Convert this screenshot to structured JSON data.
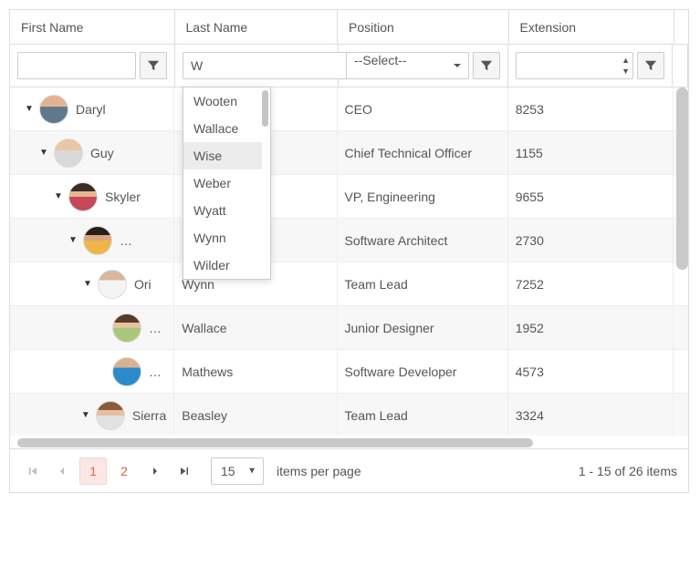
{
  "headers": {
    "firstName": "First Name",
    "lastName": "Last Name",
    "position": "Position",
    "extension": "Extension"
  },
  "filters": {
    "lastNameValue": "W",
    "positionPlaceholder": "--Select--"
  },
  "autocomplete": [
    "Wooten",
    "Wallace",
    "Wise",
    "Weber",
    "Wyatt",
    "Wynn",
    "Wilder"
  ],
  "rows": [
    {
      "first": "Daryl",
      "last": "",
      "pos": "CEO",
      "ext": "8253",
      "depth": 0,
      "alt": false,
      "expand": true,
      "trunc": false
    },
    {
      "first": "Guy",
      "last": "",
      "pos": "Chief Technical Officer",
      "ext": "1155",
      "depth": 1,
      "alt": true,
      "expand": true,
      "trunc": false
    },
    {
      "first": "Skyler",
      "last": "",
      "pos": "VP, Engineering",
      "ext": "9655",
      "depth": 2,
      "alt": false,
      "expand": true,
      "trunc": false
    },
    {
      "first": "",
      "last": "",
      "pos": "Software Architect",
      "ext": "2730",
      "depth": 3,
      "alt": true,
      "expand": true,
      "trunc": true
    },
    {
      "first": "Ori",
      "last": "Wynn",
      "pos": "Team Lead",
      "ext": "7252",
      "depth": 4,
      "alt": false,
      "expand": true,
      "trunc": false
    },
    {
      "first": "",
      "last": "Wallace",
      "pos": "Junior Designer",
      "ext": "1952",
      "depth": 5,
      "alt": true,
      "expand": false,
      "trunc": true
    },
    {
      "first": "",
      "last": "Mathews",
      "pos": "Software Developer",
      "ext": "4573",
      "depth": 5,
      "alt": false,
      "expand": false,
      "trunc": true
    },
    {
      "first": "Sierra",
      "last": "Beasley",
      "pos": "Team Lead",
      "ext": "3324",
      "depth": 4,
      "alt": true,
      "expand": true,
      "trunc": false
    }
  ],
  "pager": {
    "pages": [
      "1",
      "2"
    ],
    "activePage": 0,
    "pageSize": "15",
    "itemsPerPage": "items per page",
    "summary": "1 - 15 of 26 items"
  }
}
